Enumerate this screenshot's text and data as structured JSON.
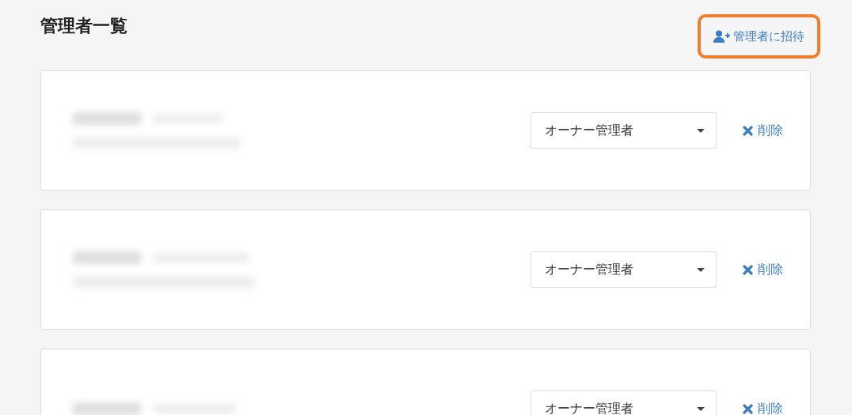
{
  "title": "管理者一覧",
  "invite_button": {
    "label": "管理者に招待",
    "highlighted": true
  },
  "admins": [
    {
      "role": "オーナー管理者",
      "delete_label": "削除"
    },
    {
      "role": "オーナー管理者",
      "delete_label": "削除"
    },
    {
      "role": "オーナー管理者",
      "delete_label": "削除"
    }
  ]
}
